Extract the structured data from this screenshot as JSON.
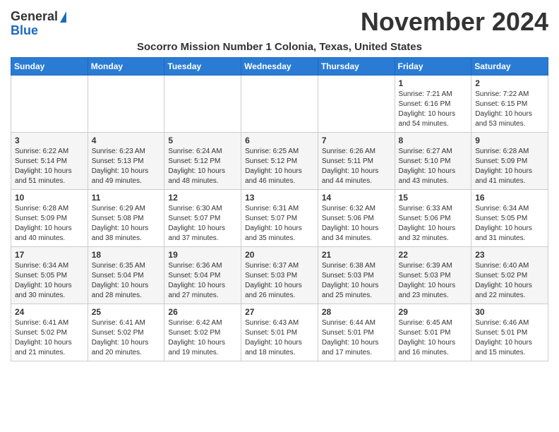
{
  "header": {
    "logo_general": "General",
    "logo_blue": "Blue",
    "month_title": "November 2024",
    "subtitle": "Socorro Mission Number 1 Colonia, Texas, United States"
  },
  "weekdays": [
    "Sunday",
    "Monday",
    "Tuesday",
    "Wednesday",
    "Thursday",
    "Friday",
    "Saturday"
  ],
  "weeks": [
    [
      {
        "day": "",
        "info": ""
      },
      {
        "day": "",
        "info": ""
      },
      {
        "day": "",
        "info": ""
      },
      {
        "day": "",
        "info": ""
      },
      {
        "day": "",
        "info": ""
      },
      {
        "day": "1",
        "info": "Sunrise: 7:21 AM\nSunset: 6:16 PM\nDaylight: 10 hours\nand 54 minutes."
      },
      {
        "day": "2",
        "info": "Sunrise: 7:22 AM\nSunset: 6:15 PM\nDaylight: 10 hours\nand 53 minutes."
      }
    ],
    [
      {
        "day": "3",
        "info": "Sunrise: 6:22 AM\nSunset: 5:14 PM\nDaylight: 10 hours\nand 51 minutes."
      },
      {
        "day": "4",
        "info": "Sunrise: 6:23 AM\nSunset: 5:13 PM\nDaylight: 10 hours\nand 49 minutes."
      },
      {
        "day": "5",
        "info": "Sunrise: 6:24 AM\nSunset: 5:12 PM\nDaylight: 10 hours\nand 48 minutes."
      },
      {
        "day": "6",
        "info": "Sunrise: 6:25 AM\nSunset: 5:12 PM\nDaylight: 10 hours\nand 46 minutes."
      },
      {
        "day": "7",
        "info": "Sunrise: 6:26 AM\nSunset: 5:11 PM\nDaylight: 10 hours\nand 44 minutes."
      },
      {
        "day": "8",
        "info": "Sunrise: 6:27 AM\nSunset: 5:10 PM\nDaylight: 10 hours\nand 43 minutes."
      },
      {
        "day": "9",
        "info": "Sunrise: 6:28 AM\nSunset: 5:09 PM\nDaylight: 10 hours\nand 41 minutes."
      }
    ],
    [
      {
        "day": "10",
        "info": "Sunrise: 6:28 AM\nSunset: 5:09 PM\nDaylight: 10 hours\nand 40 minutes."
      },
      {
        "day": "11",
        "info": "Sunrise: 6:29 AM\nSunset: 5:08 PM\nDaylight: 10 hours\nand 38 minutes."
      },
      {
        "day": "12",
        "info": "Sunrise: 6:30 AM\nSunset: 5:07 PM\nDaylight: 10 hours\nand 37 minutes."
      },
      {
        "day": "13",
        "info": "Sunrise: 6:31 AM\nSunset: 5:07 PM\nDaylight: 10 hours\nand 35 minutes."
      },
      {
        "day": "14",
        "info": "Sunrise: 6:32 AM\nSunset: 5:06 PM\nDaylight: 10 hours\nand 34 minutes."
      },
      {
        "day": "15",
        "info": "Sunrise: 6:33 AM\nSunset: 5:06 PM\nDaylight: 10 hours\nand 32 minutes."
      },
      {
        "day": "16",
        "info": "Sunrise: 6:34 AM\nSunset: 5:05 PM\nDaylight: 10 hours\nand 31 minutes."
      }
    ],
    [
      {
        "day": "17",
        "info": "Sunrise: 6:34 AM\nSunset: 5:05 PM\nDaylight: 10 hours\nand 30 minutes."
      },
      {
        "day": "18",
        "info": "Sunrise: 6:35 AM\nSunset: 5:04 PM\nDaylight: 10 hours\nand 28 minutes."
      },
      {
        "day": "19",
        "info": "Sunrise: 6:36 AM\nSunset: 5:04 PM\nDaylight: 10 hours\nand 27 minutes."
      },
      {
        "day": "20",
        "info": "Sunrise: 6:37 AM\nSunset: 5:03 PM\nDaylight: 10 hours\nand 26 minutes."
      },
      {
        "day": "21",
        "info": "Sunrise: 6:38 AM\nSunset: 5:03 PM\nDaylight: 10 hours\nand 25 minutes."
      },
      {
        "day": "22",
        "info": "Sunrise: 6:39 AM\nSunset: 5:03 PM\nDaylight: 10 hours\nand 23 minutes."
      },
      {
        "day": "23",
        "info": "Sunrise: 6:40 AM\nSunset: 5:02 PM\nDaylight: 10 hours\nand 22 minutes."
      }
    ],
    [
      {
        "day": "24",
        "info": "Sunrise: 6:41 AM\nSunset: 5:02 PM\nDaylight: 10 hours\nand 21 minutes."
      },
      {
        "day": "25",
        "info": "Sunrise: 6:41 AM\nSunset: 5:02 PM\nDaylight: 10 hours\nand 20 minutes."
      },
      {
        "day": "26",
        "info": "Sunrise: 6:42 AM\nSunset: 5:02 PM\nDaylight: 10 hours\nand 19 minutes."
      },
      {
        "day": "27",
        "info": "Sunrise: 6:43 AM\nSunset: 5:01 PM\nDaylight: 10 hours\nand 18 minutes."
      },
      {
        "day": "28",
        "info": "Sunrise: 6:44 AM\nSunset: 5:01 PM\nDaylight: 10 hours\nand 17 minutes."
      },
      {
        "day": "29",
        "info": "Sunrise: 6:45 AM\nSunset: 5:01 PM\nDaylight: 10 hours\nand 16 minutes."
      },
      {
        "day": "30",
        "info": "Sunrise: 6:46 AM\nSunset: 5:01 PM\nDaylight: 10 hours\nand 15 minutes."
      }
    ]
  ]
}
